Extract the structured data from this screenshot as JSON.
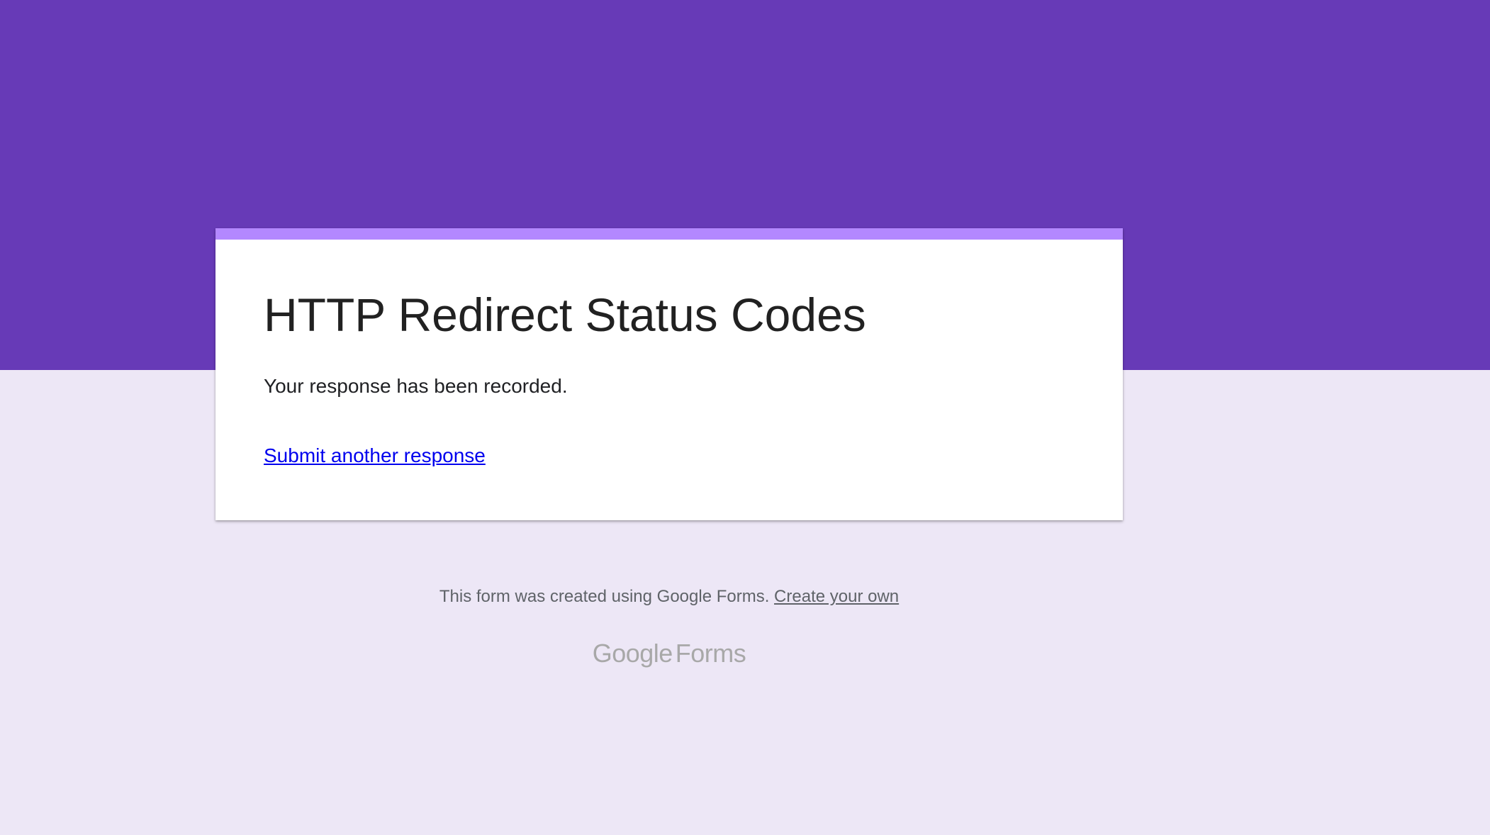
{
  "form": {
    "title": "HTTP Redirect Status Codes",
    "confirmation": "Your response has been recorded.",
    "submit_another": "Submit another response"
  },
  "footer": {
    "created_text": "This form was created using Google Forms.",
    "create_link": "Create your own"
  },
  "logo": {
    "google": "Google",
    "forms": "Forms"
  },
  "colors": {
    "header_band": "#673ab7",
    "card_accent": "#b388ff",
    "page_background": "#ede7f6",
    "link": "#0000ee"
  }
}
